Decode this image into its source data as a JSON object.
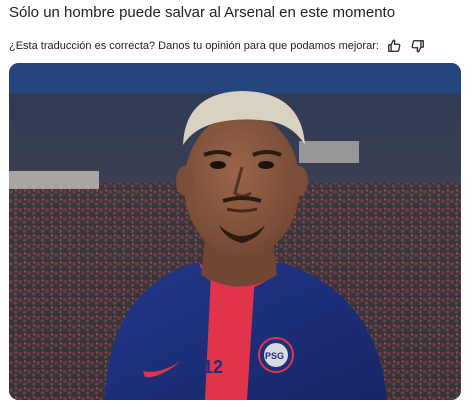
{
  "article": {
    "title": "Sólo un hombre puede salvar al Arsenal en este momento"
  },
  "feedback": {
    "prompt": "¿Esta traducción es correcta? Danos tu opinión para que podamos mejorar:",
    "like_icon": "thumbs-up-icon",
    "dislike_icon": "thumbs-down-icon"
  },
  "image": {
    "jersey_number": "12",
    "crest_text": "PARIS SAINT-GERMAIN",
    "crest_monogram": "PSG",
    "colors": {
      "jersey": "#1c2f7a",
      "stripe": "#e1344b",
      "skin": "#8a5a3f",
      "hair": "#d9d2c2"
    }
  }
}
